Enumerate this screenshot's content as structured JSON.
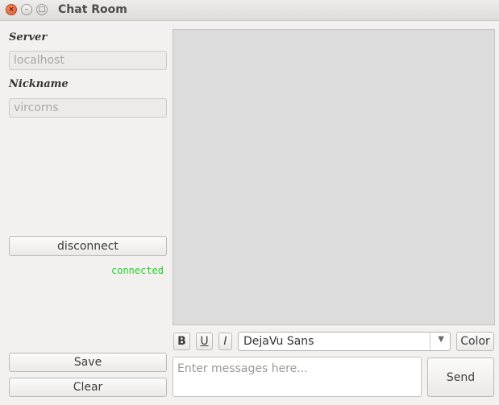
{
  "window": {
    "title": "Chat Room",
    "close_glyph": "×",
    "min_glyph": "–",
    "max_glyph": "□"
  },
  "sidebar": {
    "server_label": "Server",
    "server_value": "localhost",
    "nickname_label": "Nickname",
    "nickname_value": "vircorns",
    "disconnect_label": "disconnect",
    "status": "connected",
    "status_color": "#22d022",
    "save_label": "Save",
    "clear_label": "Clear"
  },
  "toolbar": {
    "bold_label": "B",
    "underline_label": "U",
    "italic_label": "I",
    "font_value": "DejaVu Sans",
    "dropdown_glyph": "▼",
    "color_label": "Color"
  },
  "compose": {
    "placeholder": "Enter messages here...",
    "send_label": "Send"
  }
}
